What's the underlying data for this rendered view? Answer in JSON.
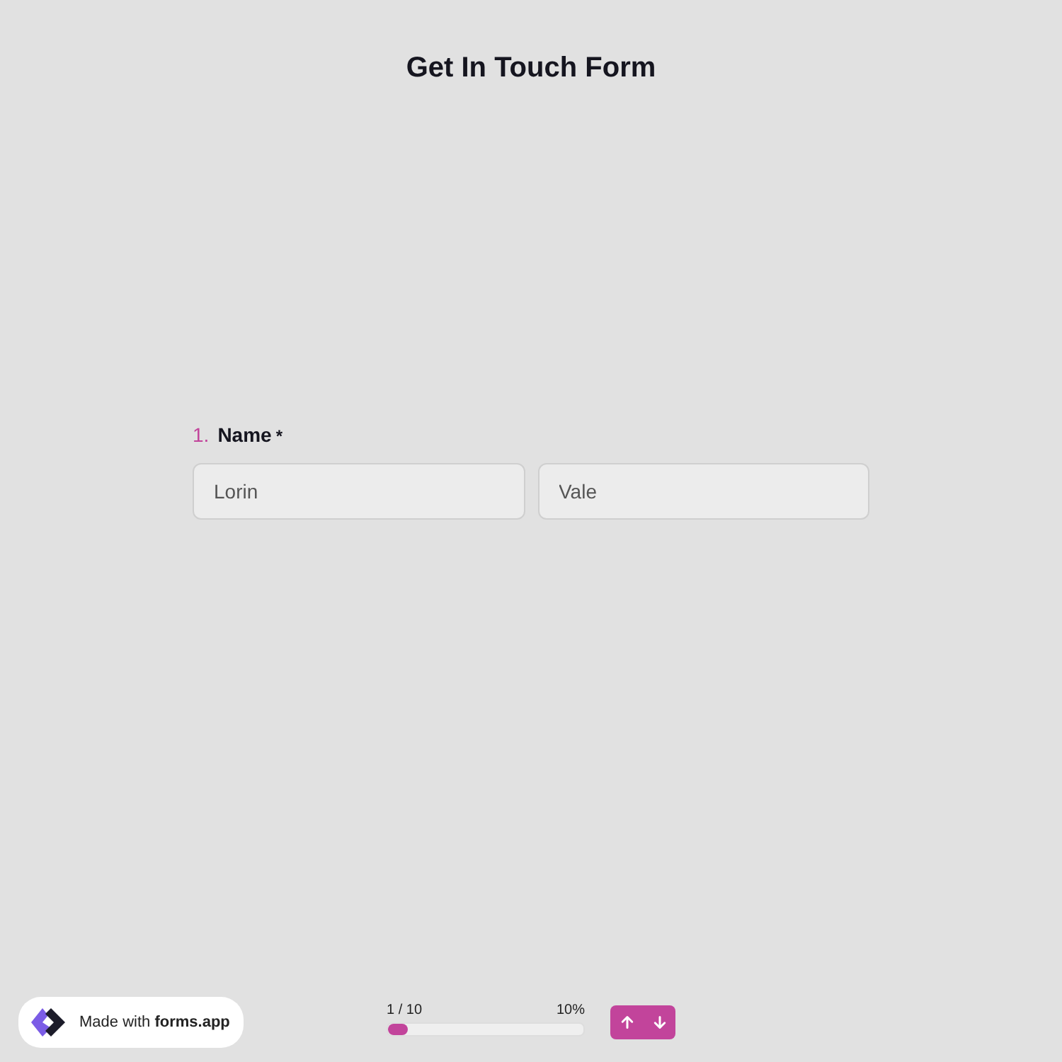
{
  "title": "Get In Touch Form",
  "question": {
    "number": "1.",
    "label": "Name",
    "required_mark": "*",
    "fields": [
      {
        "value": "Lorin"
      },
      {
        "value": "Vale"
      }
    ]
  },
  "progress": {
    "count": "1 / 10",
    "percent": "10%",
    "level": 0.1
  },
  "nav_buttons": [
    {
      "kind": "up"
    },
    {
      "kind": "down"
    }
  ],
  "badge": {
    "text": "Made with **forms.app**"
  }
}
